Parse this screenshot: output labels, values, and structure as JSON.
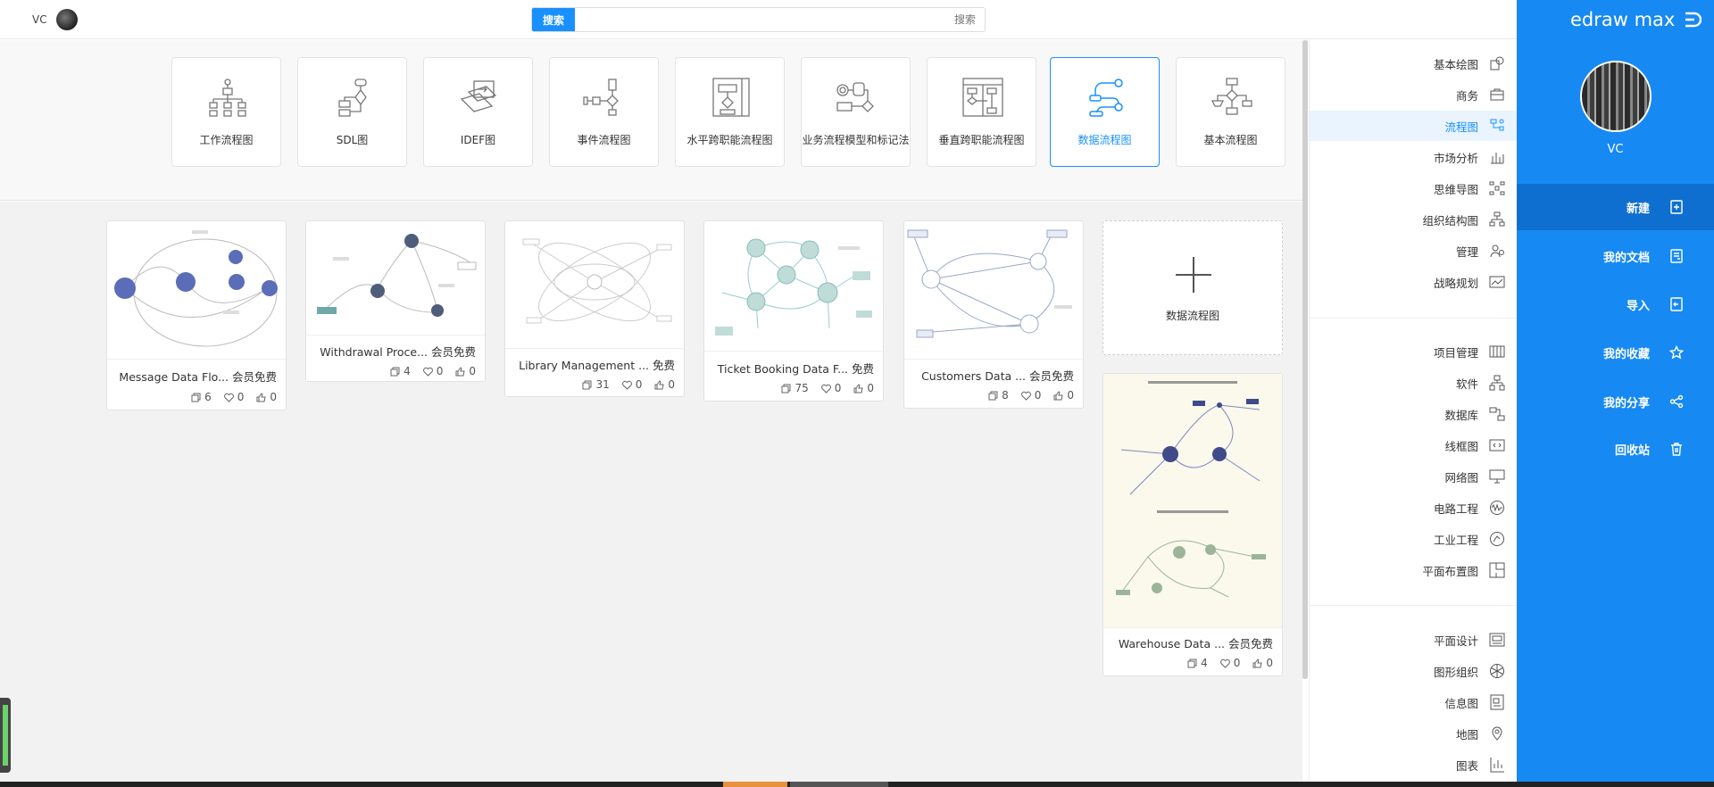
{
  "topbar": {
    "user_name": "VC",
    "search_button": "搜索",
    "search_placeholder": "搜索"
  },
  "templates": [
    {
      "label": "工作流程图",
      "icon": "org-chart-icon"
    },
    {
      "label": "SDL图",
      "icon": "sdl-icon"
    },
    {
      "label": "IDEF图",
      "icon": "idef-icon"
    },
    {
      "label": "事件流程图",
      "icon": "event-flow-icon"
    },
    {
      "label": "水平跨职能流程图",
      "icon": "horizontal-swimlane-icon"
    },
    {
      "label": "业务流程模型和标记法",
      "icon": "bpmn-icon"
    },
    {
      "label": "垂直跨职能流程图",
      "icon": "vertical-swimlane-icon"
    },
    {
      "label": "数据流程图",
      "icon": "data-flow-icon",
      "active": true
    },
    {
      "label": "基本流程图",
      "icon": "basic-flow-icon"
    }
  ],
  "new_card_label": "数据流程图",
  "examples": [
    {
      "title": "Message Data Flo...   会员免费",
      "likes": "0",
      "favorites": "0",
      "copies": "6"
    },
    {
      "title": "Withdrawal Proce...   会员免费",
      "likes": "0",
      "favorites": "0",
      "copies": "4"
    },
    {
      "title": "Library Management ...   免费",
      "likes": "0",
      "favorites": "0",
      "copies": "31"
    },
    {
      "title": "Ticket Booking Data F...   免费",
      "likes": "0",
      "favorites": "0",
      "copies": "75"
    },
    {
      "title": "Customers Data ...   会员免费",
      "likes": "0",
      "favorites": "0",
      "copies": "8"
    },
    {
      "title": "Warehouse Data ...   会员免费",
      "likes": "0",
      "favorites": "0",
      "copies": "4"
    }
  ],
  "categories_group1": [
    {
      "label": "基本绘图",
      "icon": "basic-drawing-icon"
    },
    {
      "label": "商务",
      "icon": "briefcase-icon"
    },
    {
      "label": "流程图",
      "icon": "flowchart-icon",
      "active": true
    },
    {
      "label": "市场分析",
      "icon": "bar-chart-icon"
    },
    {
      "label": "思维导图",
      "icon": "mindmap-icon"
    },
    {
      "label": "组织结构图",
      "icon": "org-structure-icon"
    },
    {
      "label": "管理",
      "icon": "management-icon"
    },
    {
      "label": "战略规划",
      "icon": "strategy-icon"
    }
  ],
  "categories_group2": [
    {
      "label": "项目管理",
      "icon": "gantt-icon"
    },
    {
      "label": "软件",
      "icon": "software-icon"
    },
    {
      "label": "数据库",
      "icon": "database-icon"
    },
    {
      "label": "线框图",
      "icon": "wireframe-icon"
    },
    {
      "label": "网络图",
      "icon": "network-icon"
    },
    {
      "label": "电路工程",
      "icon": "circuit-icon"
    },
    {
      "label": "工业工程",
      "icon": "industrial-icon"
    },
    {
      "label": "平面布置图",
      "icon": "floorplan-icon"
    }
  ],
  "categories_group3": [
    {
      "label": "平面设计",
      "icon": "graphic-design-icon"
    },
    {
      "label": "图形组织",
      "icon": "graphic-organizer-icon"
    },
    {
      "label": "信息图",
      "icon": "infographic-icon"
    },
    {
      "label": "地图",
      "icon": "map-pin-icon"
    },
    {
      "label": "图表",
      "icon": "chart-icon"
    }
  ],
  "nav": {
    "brand": "edraw max",
    "user_name": "VC",
    "items": [
      {
        "label": "新建",
        "icon": "new-file-icon",
        "active": true
      },
      {
        "label": "我的文档",
        "icon": "documents-icon"
      },
      {
        "label": "导入",
        "icon": "import-icon"
      },
      {
        "label": "我的收藏",
        "icon": "star-icon"
      },
      {
        "label": "我的分享",
        "icon": "share-icon"
      },
      {
        "label": "回收站",
        "icon": "trash-icon"
      }
    ]
  },
  "colors": {
    "accent": "#1890ff",
    "nav_bg": "#1789f2",
    "nav_active": "#0f6fd0"
  }
}
